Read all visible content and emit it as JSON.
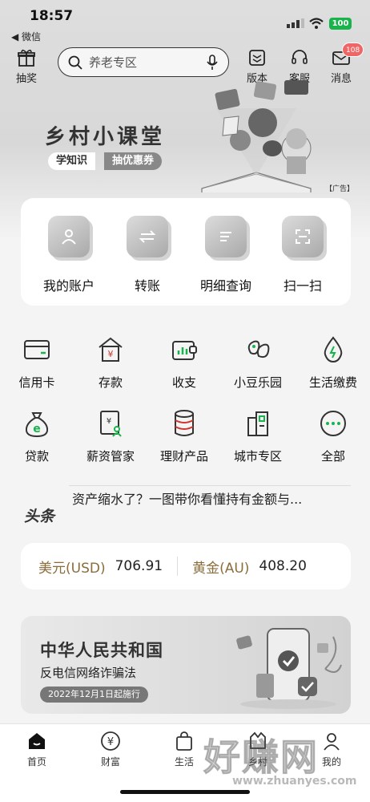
{
  "status_bar": {
    "time": "18:57",
    "back_app": "◀ 微信",
    "battery": "100"
  },
  "header": {
    "left_button": {
      "label": "抽奖",
      "icon": "gift-icon"
    },
    "search": {
      "placeholder": "养老专区",
      "icons": [
        "search-icon",
        "microphone-icon"
      ]
    },
    "right_buttons": [
      {
        "label": "版本",
        "icon": "version-icon"
      },
      {
        "label": "客服",
        "icon": "headset-icon"
      },
      {
        "label": "消息",
        "icon": "mail-icon",
        "badge": "108"
      }
    ]
  },
  "banner": {
    "title": "乡村小课堂",
    "tag1": "学知识",
    "tag2": "抽优惠券",
    "ad_label": "【广告】"
  },
  "quick_actions": [
    {
      "label": "我的账户",
      "icon": "user-icon"
    },
    {
      "label": "转账",
      "icon": "transfer-icon"
    },
    {
      "label": "明细查询",
      "icon": "document-icon"
    },
    {
      "label": "扫一扫",
      "icon": "scan-icon"
    }
  ],
  "services": [
    {
      "label": "信用卡",
      "icon": "credit-card-icon"
    },
    {
      "label": "存款",
      "icon": "deposit-house-icon"
    },
    {
      "label": "收支",
      "icon": "wallet-chart-icon"
    },
    {
      "label": "小豆乐园",
      "icon": "bean-icon"
    },
    {
      "label": "生活缴费",
      "icon": "water-drop-icon"
    },
    {
      "label": "贷款",
      "icon": "money-bag-icon"
    },
    {
      "label": "薪资管家",
      "icon": "salary-document-icon"
    },
    {
      "label": "理财产品",
      "icon": "coin-stack-icon"
    },
    {
      "label": "城市专区",
      "icon": "city-buildings-icon"
    },
    {
      "label": "全部",
      "icon": "more-dots-icon"
    }
  ],
  "headline": {
    "logo": "头条",
    "text": "资产缩水了？一图带你看懂持有金额与..."
  },
  "rates": [
    {
      "name": "美元(USD)",
      "value": "706.91"
    },
    {
      "name": "黄金(AU)",
      "value": "408.20"
    }
  ],
  "promo": {
    "title": "中华人民共和国",
    "subtitle": "反电信网络诈骗法",
    "date": "2022年12月1日起施行"
  },
  "tabs": [
    {
      "label": "首页",
      "icon": "home-icon",
      "active": true
    },
    {
      "label": "财富",
      "icon": "yuan-coin-icon"
    },
    {
      "label": "生活",
      "icon": "shopping-bag-icon"
    },
    {
      "label": "乡村",
      "icon": "village-icon"
    },
    {
      "label": "我的",
      "icon": "profile-icon"
    }
  ],
  "watermark": {
    "text": "好赚网",
    "url": "www.zhuanyes.com"
  },
  "colors": {
    "accent_green": "#18b34b",
    "gold_label": "#8a6d3b",
    "badge_red": "#e66666"
  }
}
